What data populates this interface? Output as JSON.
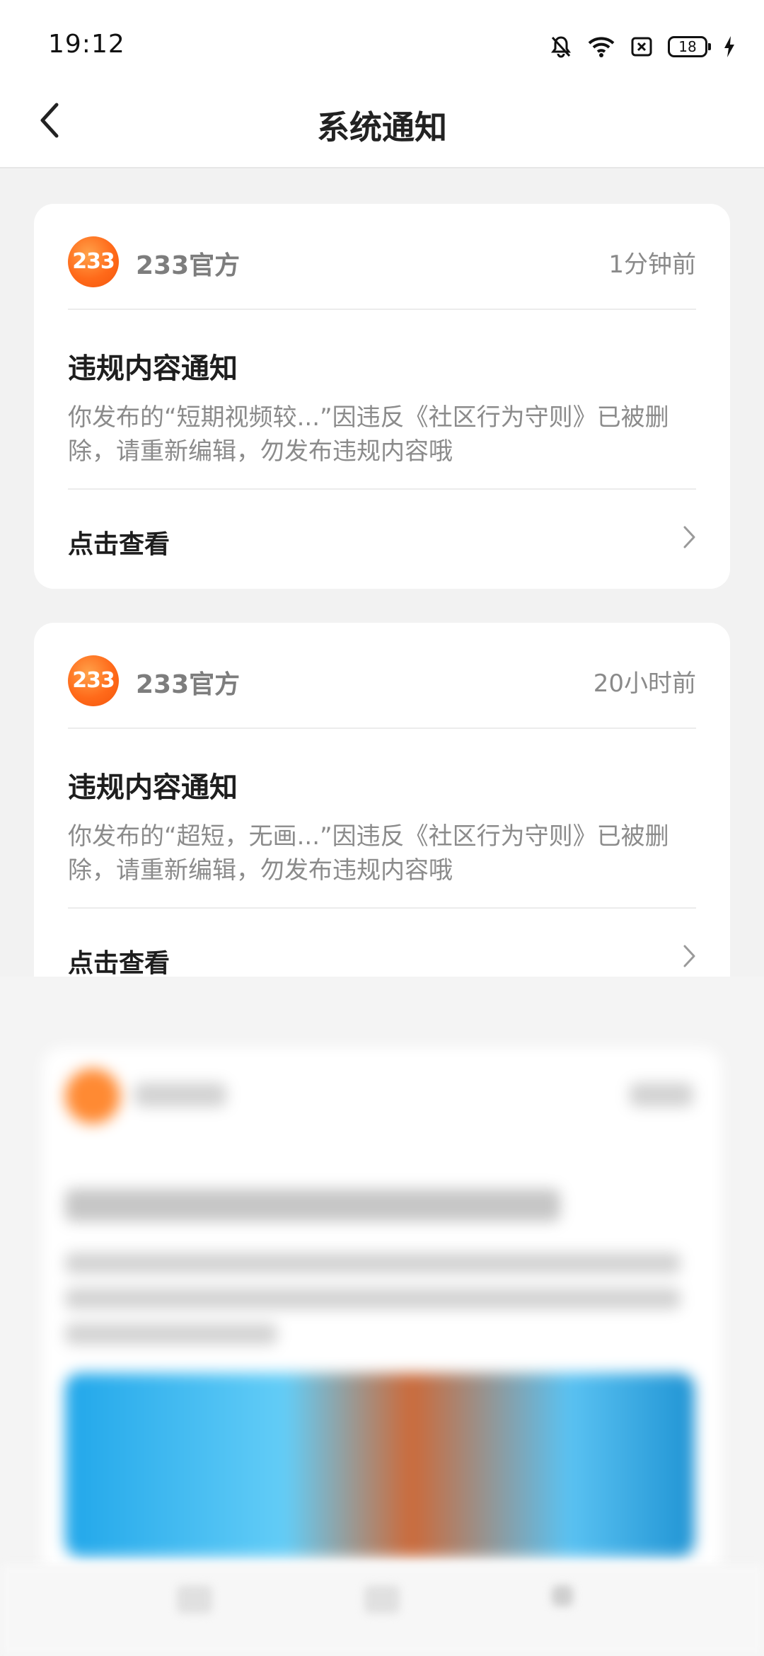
{
  "status_bar": {
    "time": "19:12",
    "battery": "18",
    "icons": [
      "bell-muted-icon",
      "wifi-icon",
      "sim-card-icon",
      "battery-icon",
      "charging-icon"
    ]
  },
  "header": {
    "title": "系统通知",
    "back_icon": "back-arrow-icon"
  },
  "notifications": [
    {
      "sender": "233官方",
      "avatar_text": "233",
      "time": "1分钟前",
      "title": "违规内容通知",
      "body": "你发布的“短期视频较...”因违反《社区行为守则》已被删除，请重新编辑，勿发布违规内容哦",
      "link": "点击查看"
    },
    {
      "sender": "233官方",
      "avatar_text": "233",
      "time": "20小时前",
      "title": "违规内容通知",
      "body": "你发布的“超短，无画...”因违反《社区行为守则》已被删除，请重新编辑，勿发布违规内容哦",
      "link": "点击查看"
    }
  ],
  "colors": {
    "avatar_orange": "#ff6a1a",
    "background": "#f2f2f2",
    "card": "#ffffff"
  }
}
